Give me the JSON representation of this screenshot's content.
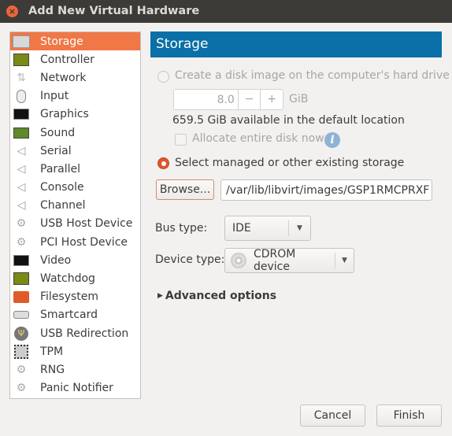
{
  "window": {
    "title": "Add New Virtual Hardware"
  },
  "sidebar": {
    "items": [
      {
        "label": "Storage",
        "icon": "harddisk-icon",
        "selected": true
      },
      {
        "label": "Controller",
        "icon": "pci-card-icon"
      },
      {
        "label": "Network",
        "icon": "network-arrows-icon"
      },
      {
        "label": "Input",
        "icon": "mouse-icon"
      },
      {
        "label": "Graphics",
        "icon": "monitor-icon"
      },
      {
        "label": "Sound",
        "icon": "sound-card-icon"
      },
      {
        "label": "Serial",
        "icon": "serial-connector-icon"
      },
      {
        "label": "Parallel",
        "icon": "parallel-connector-icon"
      },
      {
        "label": "Console",
        "icon": "console-connector-icon"
      },
      {
        "label": "Channel",
        "icon": "channel-connector-icon"
      },
      {
        "label": "USB Host Device",
        "icon": "gears-icon"
      },
      {
        "label": "PCI Host Device",
        "icon": "gears-icon"
      },
      {
        "label": "Video",
        "icon": "monitor-icon"
      },
      {
        "label": "Watchdog",
        "icon": "pci-card-icon"
      },
      {
        "label": "Filesystem",
        "icon": "folder-icon"
      },
      {
        "label": "Smartcard",
        "icon": "smartcard-reader-icon"
      },
      {
        "label": "USB Redirection",
        "icon": "usb-icon"
      },
      {
        "label": "TPM",
        "icon": "chip-icon"
      },
      {
        "label": "RNG",
        "icon": "gears-icon"
      },
      {
        "label": "Panic Notifier",
        "icon": "gears-icon"
      }
    ]
  },
  "main": {
    "header": "Storage",
    "create_disk_label": "Create a disk image on the computer's hard drive",
    "size_value": "8.0",
    "minus": "−",
    "plus": "+",
    "size_unit": "GiB",
    "available": "659.5 GiB available in the default location",
    "allocate_label": "Allocate entire disk now",
    "select_label": "Select managed or other existing storage",
    "browse_label": "Browse...",
    "path_value": "/var/lib/libvirt/images/GSP1RMCPRXF",
    "bus_label": "Bus type:",
    "bus_value": "IDE",
    "device_label": "Device type:",
    "device_value": "CDROM device",
    "advanced_label": "Advanced options"
  },
  "footer": {
    "cancel": "Cancel",
    "finish": "Finish"
  },
  "colors": {
    "selection": "#f07746",
    "header": "#0b6fa8",
    "titlebar": "#3c3b37"
  }
}
